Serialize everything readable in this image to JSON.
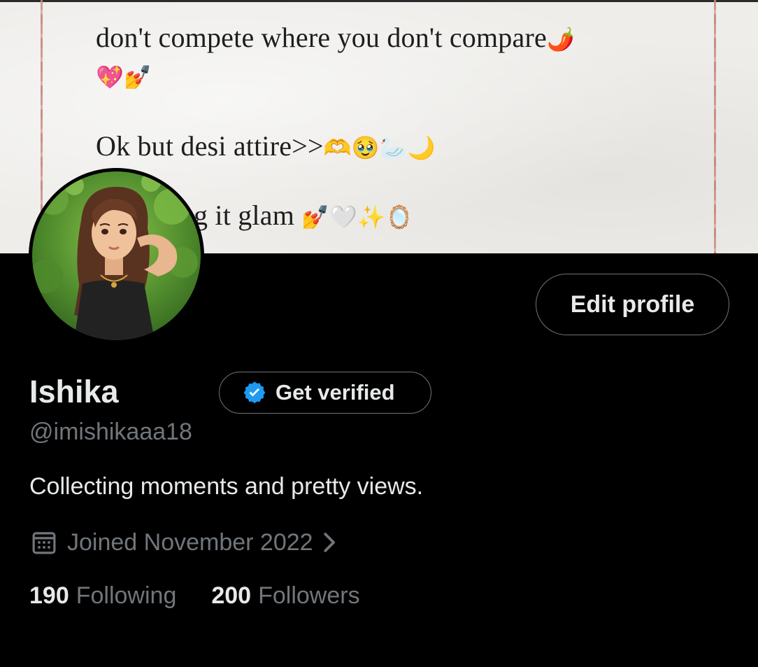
{
  "banner": {
    "lines": [
      "don't compete where you don't compare",
      "",
      "Ok but desi attire>>",
      "g it glam"
    ],
    "emojis": {
      "line1": "🌶️",
      "line2": "💖💅",
      "line3": "🫶🥹🦢🌙",
      "line4": "💅🤍✨🪞"
    }
  },
  "profile": {
    "name": "Ishika",
    "handle": "@imishikaaa18",
    "bio": "Collecting moments and pretty views.",
    "joined": "Joined November 2022",
    "edit_label": "Edit profile",
    "verify_label": "Get verified",
    "following_count": "190",
    "following_label": "Following",
    "followers_count": "200",
    "followers_label": "Followers"
  },
  "colors": {
    "background": "#000000",
    "primary_text": "#e7e9ea",
    "secondary_text": "#71767b",
    "border": "#6f7478",
    "verified_blue": "#1d9bf0"
  },
  "icons": {
    "verified": "verified-badge-icon",
    "calendar": "calendar-icon",
    "chevron": "chevron-right-icon"
  }
}
